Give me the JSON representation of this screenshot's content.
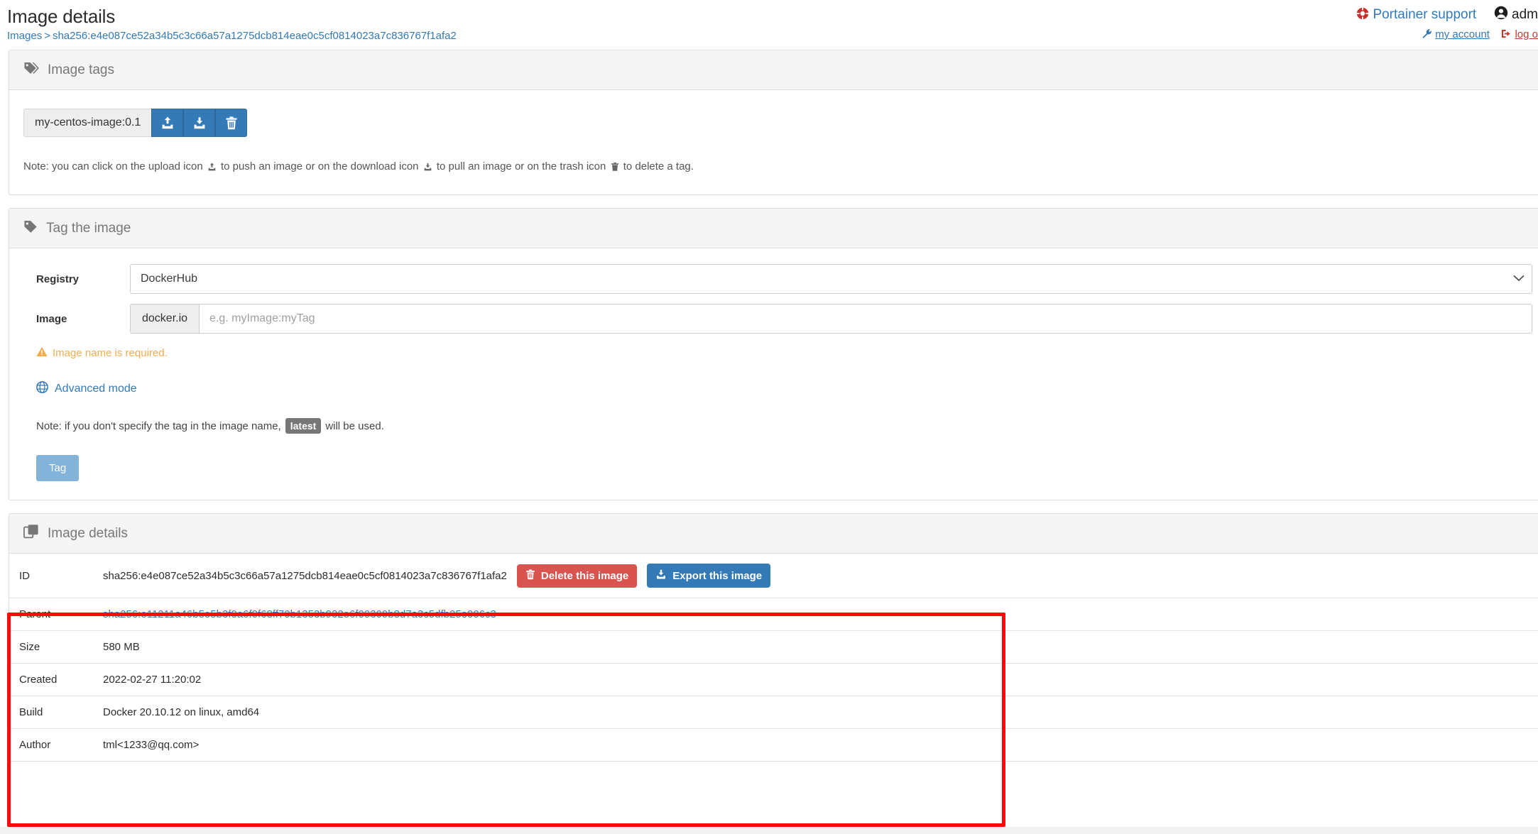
{
  "header": {
    "title": "Image details",
    "breadcrumb": {
      "root": "Images",
      "separator": ">",
      "current": "sha256:e4e087ce52a34b5c3c66a57a1275dcb814eae0c5cf0814023a7c836767f1afa2"
    },
    "support_label": "Portainer support",
    "user_name": "adm",
    "my_account_label": "my account",
    "logout_label": "log o"
  },
  "image_tags": {
    "panel_title": "Image tags",
    "tag_value": "my-centos-image:0.1",
    "actions": {
      "push_title": "push",
      "pull_title": "pull",
      "delete_title": "delete"
    },
    "note_parts": {
      "p1": "Note: you can click on the upload icon",
      "p2": "to push an image or on the download icon",
      "p3": "to pull an image or on the trash icon",
      "p4": "to delete a tag."
    }
  },
  "tag_image": {
    "panel_title": "Tag the image",
    "registry_label": "Registry",
    "registry_value": "DockerHub",
    "image_label": "Image",
    "image_addon": "docker.io",
    "image_placeholder": "e.g. myImage:myTag",
    "image_value": "",
    "error_message": "Image name is required.",
    "advanced_mode_label": "Advanced mode",
    "latest_note_prefix": "Note: if you don't specify the tag in the image name,",
    "latest_chip": "latest",
    "latest_note_suffix": "will be used.",
    "tag_button_label": "Tag"
  },
  "image_details": {
    "panel_title": "Image details",
    "delete_button_label": "Delete this image",
    "export_button_label": "Export this image",
    "rows": [
      {
        "key": "ID",
        "value": "sha256:e4e087ce52a34b5c3c66a57a1275dcb814eae0c5cf0814023a7c836767f1afa2"
      },
      {
        "key": "Parent",
        "value": "sha256:e11211a46b5e5b3f0a6f0f68ff70b1353b932e6f09309b8d7a3c5dfb25e006c3"
      },
      {
        "key": "Size",
        "value": "580 MB"
      },
      {
        "key": "Created",
        "value": "2022-02-27 11:20:02"
      },
      {
        "key": "Build",
        "value": "Docker 20.10.12 on linux, amd64"
      },
      {
        "key": "Author",
        "value": "tml<1233@qq.com>"
      }
    ]
  },
  "colors": {
    "link": "#337ab7",
    "danger": "#d9534f",
    "warning": "#f0ad4e",
    "annotation": "#fb0b06",
    "panel_heading_bg": "#f5f5f5"
  }
}
